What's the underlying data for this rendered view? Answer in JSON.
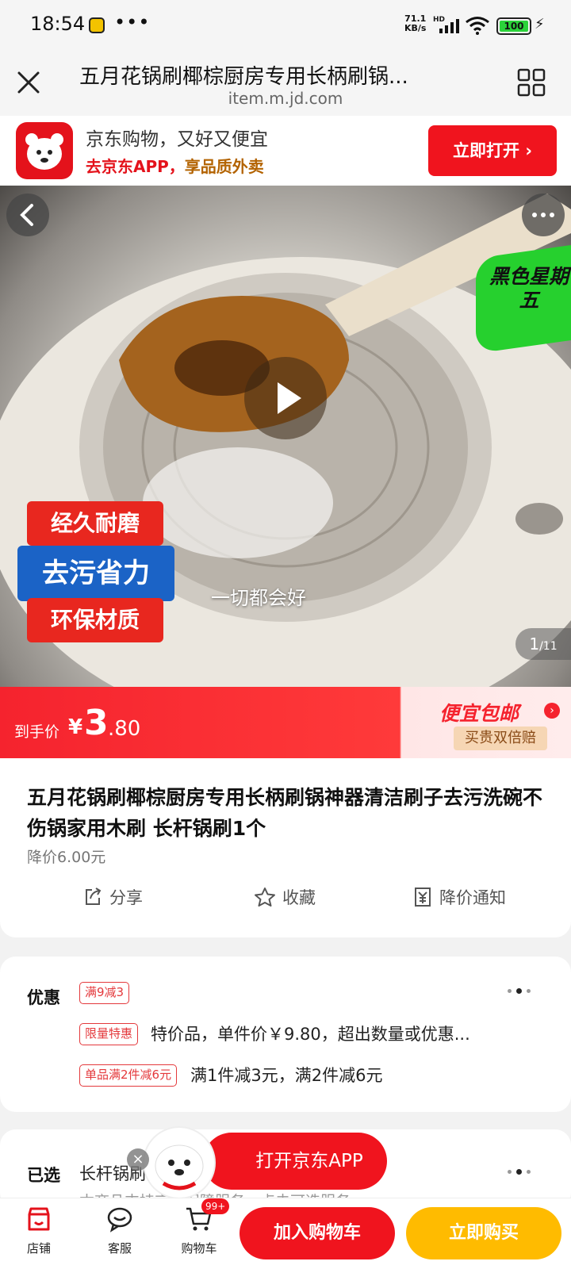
{
  "status_bar": {
    "time": "18:54",
    "dots": "•••",
    "speed_top": "71.1",
    "speed_bottom": "KB/s",
    "hd": "HD",
    "battery": "100"
  },
  "title_bar": {
    "title": "五月花锅刷椰棕厨房专用长柄刷锅...",
    "url": "item.m.jd.com",
    "icons": [
      "close-icon",
      "grid-menu-icon"
    ]
  },
  "app_banner": {
    "line1": "京东购物，又好又便宜",
    "line2_prefix": "去京东APP，",
    "line2_highlight": "享品质外卖",
    "open_button": "立即打开",
    "open_button_arrow": "›"
  },
  "hero": {
    "green_tag": "黑色星期五",
    "badge_1": "经久耐磨",
    "badge_2": "去污省力",
    "badge_3": "环保材质",
    "caption": "一切都会好",
    "pager_current": "1",
    "pager_total": "/11"
  },
  "price_bar": {
    "label": "到手价",
    "currency": "¥",
    "price_int": "3",
    "price_dec": ".80",
    "promo_title": "便宜包邮",
    "promo_sub": "买贵双倍赔",
    "colors": {
      "red": "#f5232e",
      "gold": "#f6d6b4"
    }
  },
  "product": {
    "title": "五月花锅刷椰棕厨房专用长柄刷锅神器清洁刷子去污洗碗不伤锅家用木刷 长杆锅刷1个",
    "price_drop": "降价6.00元",
    "actions": {
      "share": "分享",
      "favorite": "收藏",
      "notify": "降价通知"
    }
  },
  "coupons": {
    "label": "优惠",
    "chip_1": "满9减3",
    "chip_2": "限量特惠",
    "text_2": "特价品，单件价￥9.80，超出数量或优惠...",
    "chip_3": "单品满2件减6元",
    "text_3": "满1件减3元，满2件减6元"
  },
  "selected": {
    "label": "已选",
    "value": "长杆锅刷1个",
    "hint": "本商品支持京东保障服务，点击可选服务"
  },
  "floating": {
    "open_app": "打开京东APP",
    "close": "×"
  },
  "bottom_nav": {
    "shop": "店铺",
    "service": "客服",
    "cart": "购物车",
    "cart_badge": "99+",
    "add_to_cart": "加入购物车",
    "buy_now": "立即购买"
  }
}
